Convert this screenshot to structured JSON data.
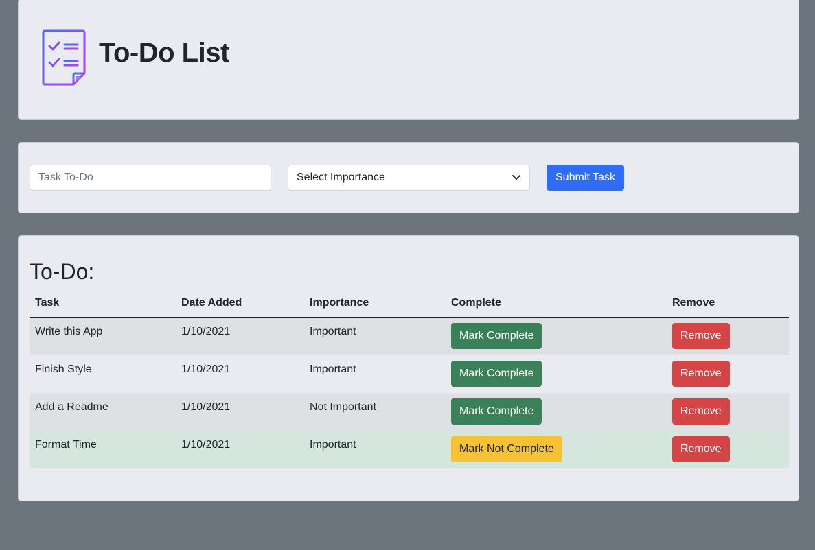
{
  "header": {
    "title": "To-Do List",
    "logo_icon": "checklist-icon"
  },
  "form": {
    "task_placeholder": "Task To-Do",
    "importance_selected": "Select Importance",
    "submit_label": "Submit Task"
  },
  "list": {
    "heading": "To-Do:",
    "columns": [
      "Task",
      "Date Added",
      "Importance",
      "Complete",
      "Remove"
    ],
    "rows": [
      {
        "task": "Write this App",
        "date": "1/10/2021",
        "importance": "Important",
        "complete_label": "Mark Complete",
        "remove_label": "Remove",
        "completed": false
      },
      {
        "task": "Finish Style",
        "date": "1/10/2021",
        "importance": "Important",
        "complete_label": "Mark Complete",
        "remove_label": "Remove",
        "completed": false
      },
      {
        "task": "Add a Readme",
        "date": "1/10/2021",
        "importance": "Not Important",
        "complete_label": "Mark Complete",
        "remove_label": "Remove",
        "completed": false
      },
      {
        "task": "Format Time",
        "date": "1/10/2021",
        "importance": "Important",
        "complete_label": "Mark Not Complete",
        "remove_label": "Remove",
        "completed": true
      }
    ]
  },
  "colors": {
    "background": "#6c757d",
    "card": "#e9ebf0",
    "primary": "#2f6df6",
    "success": "#3a8058",
    "warning": "#f5c233",
    "danger": "#d64545",
    "completed_row": "#d4e6dd"
  }
}
